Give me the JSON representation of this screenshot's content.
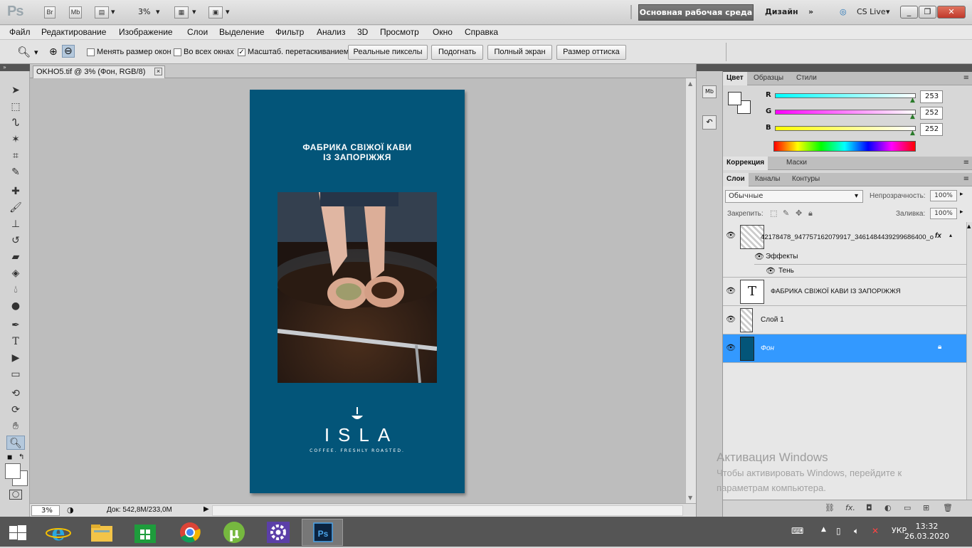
{
  "appbar": {
    "logo": "Ps",
    "br_label": "Br",
    "mb_label": "Mb",
    "zoom": "3%",
    "workspace_active": "Основная рабочая среда",
    "workspace_design": "Дизайн",
    "cs_live": "CS Live"
  },
  "menu": [
    "Файл",
    "Редактирование",
    "Изображение",
    "Слои",
    "Выделение",
    "Фильтр",
    "Анализ",
    "3D",
    "Просмотр",
    "Окно",
    "Справка"
  ],
  "options": {
    "resize_windows": "Менять размер окон",
    "all_windows": "Во всех окнах",
    "scrubby_zoom": "Масштаб. перетаскиванием",
    "actual_pixels": "Реальные пикселы",
    "fit_screen": "Подогнать",
    "fill_screen": "Полный экран",
    "print_size": "Размер оттиска",
    "scrubby_checked": "✓"
  },
  "document": {
    "tab_title": "OKHO5.tif @ 3% (Фон, RGB/8)",
    "close": "×",
    "zoom": "3%",
    "doc_info": "Док: 542,8M/233,0M",
    "poster_title": "ФАБРИКА СВІЖОЇ КАВИ\nІЗ ЗАПОРІЖЖЯ",
    "brand": "ISLA",
    "brand_tagline": "COFFEE. FRESHLY ROASTED.",
    "poster_color": "#035579"
  },
  "color_panel": {
    "tabs": [
      "Цвет",
      "Образцы",
      "Стили"
    ],
    "r_label": "R",
    "r": "253",
    "g_label": "G",
    "g": "252",
    "b_label": "B",
    "b": "252"
  },
  "adjust_panel": {
    "tabs": [
      "Коррекция",
      "Маски"
    ]
  },
  "layers_panel": {
    "tabs": [
      "Слои",
      "Каналы",
      "Контуры"
    ],
    "blend_mode": "Обычные",
    "opacity_label": "Непрозрачность:",
    "opacity": "100%",
    "lock_label": "Закрепить:",
    "fill_label": "Заливка:",
    "fill": "100%",
    "layers": [
      {
        "name": "42178478_947757162079917_3461484439299686400_o",
        "fx": "fx",
        "effects": "Эффекты",
        "effect": "Тень"
      },
      {
        "name": "ФАБРИКА СВІЖОЇ КАВИ  ІЗ ЗАПОРІЖЖЯ",
        "thumb": "T"
      },
      {
        "name": "Слой 1"
      },
      {
        "name": "Фон"
      }
    ],
    "selected_color": "#3399ff"
  },
  "watermark": {
    "title": "Активация Windows",
    "line1": "Чтобы активировать Windows, перейдите к",
    "line2": "параметрам компьютера."
  },
  "taskbar": {
    "lang": "УКР",
    "time": "13:32",
    "date": "26.03.2020"
  }
}
